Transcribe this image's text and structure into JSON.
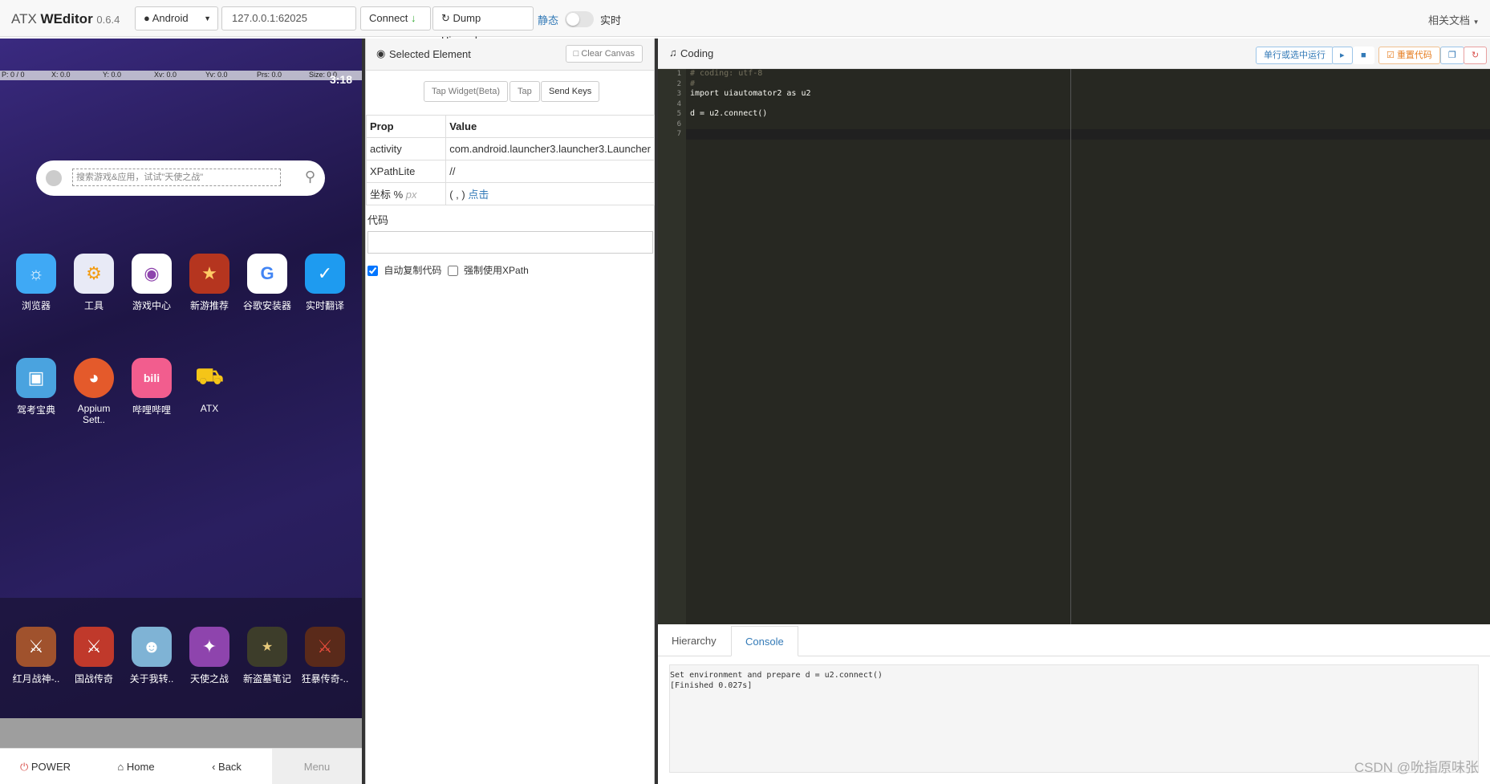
{
  "header": {
    "brand_prefix": "ATX ",
    "brand_name": "WEditor",
    "version": "0.6.4",
    "platform": "Android",
    "device_address": "127.0.0.1:62025",
    "connect_label": "Connect",
    "dump_label": "Dump Hierarchy",
    "mode_static": "静态",
    "mode_realtime": "实时",
    "docs_label": "相关文档"
  },
  "phone": {
    "statusbar": {
      "p": "P: 0 / 0",
      "x": "X: 0.0",
      "y": "Y: 0.0",
      "xv": "Xv: 0.0",
      "yv": "Yv: 0.0",
      "prs": "Prs: 0.0",
      "size": "Size: 0.0"
    },
    "time": "3:18",
    "search_placeholder": "搜索游戏&应用，试试\"天使之战\"",
    "apps_row1": [
      "浏览器",
      "工具",
      "游戏中心",
      "新游推荐",
      "谷歌安装器",
      "实时翻译"
    ],
    "apps_row2": [
      "驾考宝典",
      "Appium Sett..",
      "哔哩哔哩",
      "ATX"
    ],
    "dock_apps": [
      "红月战神-..",
      "国战传奇",
      "关于我转..",
      "天使之战",
      "新盗墓笔记",
      "狂暴传奇-.."
    ],
    "nav": {
      "power": "POWER",
      "home": "Home",
      "back": "Back",
      "menu": "Menu"
    }
  },
  "inspector": {
    "title": "Selected Element",
    "clear_canvas": "Clear Canvas",
    "tap_widget": "Tap Widget(Beta)",
    "tap": "Tap",
    "send_keys": "Send Keys",
    "col_prop": "Prop",
    "col_value": "Value",
    "rows": [
      {
        "prop": "activity",
        "value": "com.android.launcher3.launcher3.Launcher"
      },
      {
        "prop": "XPathLite",
        "value": "//"
      },
      {
        "prop": "坐标 %",
        "value": "( , )"
      }
    ],
    "coord_unit": "px",
    "click_link": "点击",
    "code_label": "代码",
    "auto_copy": "自动复制代码",
    "force_xpath": "强制使用XPath"
  },
  "coding": {
    "title": "Coding",
    "run_selected": "单行或选中运行",
    "reset_code": "重置代码",
    "line_numbers": [
      "1",
      "2",
      "3",
      "4",
      "5",
      "6",
      "7"
    ],
    "lines": [
      "# coding: utf-8",
      "#",
      "import uiautomator2 as u2",
      "",
      "d = u2.connect()",
      "",
      ""
    ],
    "tab_hierarchy": "Hierarchy",
    "tab_console": "Console",
    "console_lines": [
      "Set environment and prepare d = u2.connect()",
      "[Finished 0.027s]"
    ]
  },
  "watermark": "CSDN @吮指原味张"
}
